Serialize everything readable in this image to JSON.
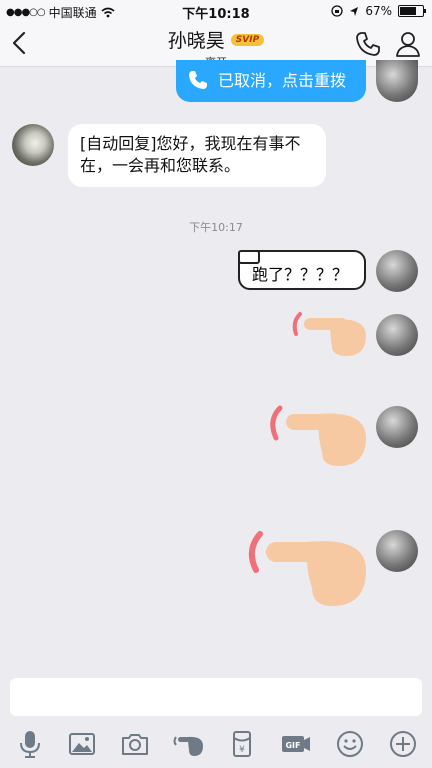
{
  "status_bar": {
    "signal_dots": "●●●○○",
    "carrier": "中国联通",
    "time": "下午10:18",
    "battery_text": "67%"
  },
  "header": {
    "title": "孙晓昊",
    "badge": "SVIP",
    "subtitle": "离开"
  },
  "messages": {
    "call_cancelled": "已取消，点击重拨",
    "auto_reply": "[自动回复]您好，我现在有事不在，一会再和您联系。",
    "timestamp": "下午10:17",
    "sent_text": "跑了？？？？"
  },
  "toolbar": {
    "icons": [
      "mic-icon",
      "image-icon",
      "camera-icon",
      "poke-icon",
      "red-packet-icon",
      "gif-icon",
      "emoji-icon",
      "plus-icon"
    ]
  },
  "colors": {
    "accent_blue": "#2aa8ff",
    "svip_gold": "#f3c23a",
    "icon_gray": "#6e7b87",
    "poke_hand": "#f7c9a3",
    "poke_arc": "#f0707a"
  }
}
